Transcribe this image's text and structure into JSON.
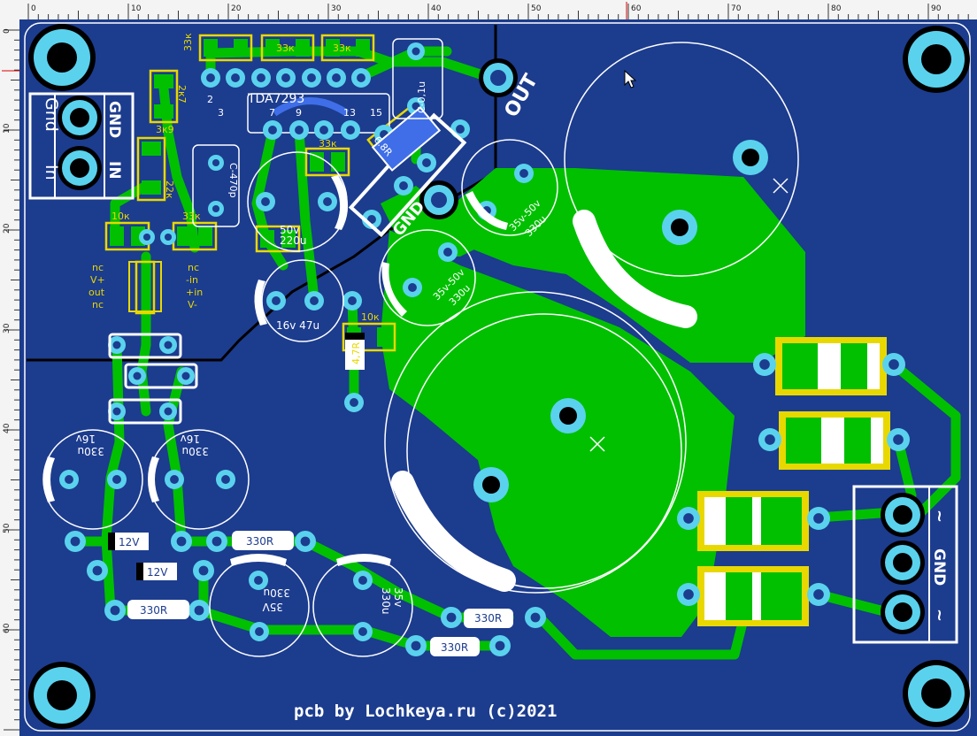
{
  "ruler": {
    "unit": "mm",
    "top_ticks": [
      "0",
      "10",
      "20",
      "30",
      "40",
      "50",
      "60",
      "70",
      "80",
      "90"
    ],
    "left_ticks": [
      "0",
      "10",
      "20",
      "30",
      "40",
      "50",
      "60"
    ]
  },
  "board": {
    "colors": {
      "substrate": "#1c3c8e",
      "copper": "#00c000",
      "pad": "#5ad2ee",
      "silk": "#ffffff",
      "label": "#e8d800"
    },
    "ic": {
      "name": "TDA7293",
      "pins": [
        "2",
        "3",
        "7",
        "9",
        "13",
        "15"
      ]
    },
    "input": {
      "gnd_silk": "Gnd",
      "in_silk": "In",
      "gnd_label": "GND",
      "in_label": "IN"
    },
    "output": {
      "out_label": "OUT",
      "gnd_label": "GND"
    },
    "power": {
      "pin1": "~",
      "pin2": "GND",
      "pin3": "~"
    },
    "caps": {
      "c_01u": "C-0,1u",
      "c_470p": "C-470p",
      "c_50v": "50v",
      "c_220u": "220u",
      "c_16v_47u": "16v 47u",
      "c_35v50v": "35v-50v",
      "c_330u": "330u",
      "c_16v": "16v",
      "c_35v": "35v",
      "c_35v_alt": "35V"
    },
    "resistors": {
      "r_33k": "33к",
      "r_2k7": "2к7",
      "r_3k9": "3к9",
      "r_33k_b": "33к",
      "r_10k": "10к",
      "r_6r8": "6.8R",
      "r_4r7": "4,7R",
      "r_330r": "330R",
      "r_22k": "22к"
    },
    "diodes": {
      "zener": "12V"
    },
    "opamp": {
      "left": [
        "nc",
        "V+",
        "out",
        "nc"
      ],
      "right": [
        "nc",
        "-in",
        "+in",
        "V-"
      ]
    },
    "credit": "pcb by Lochkeya.ru (c)2021"
  }
}
